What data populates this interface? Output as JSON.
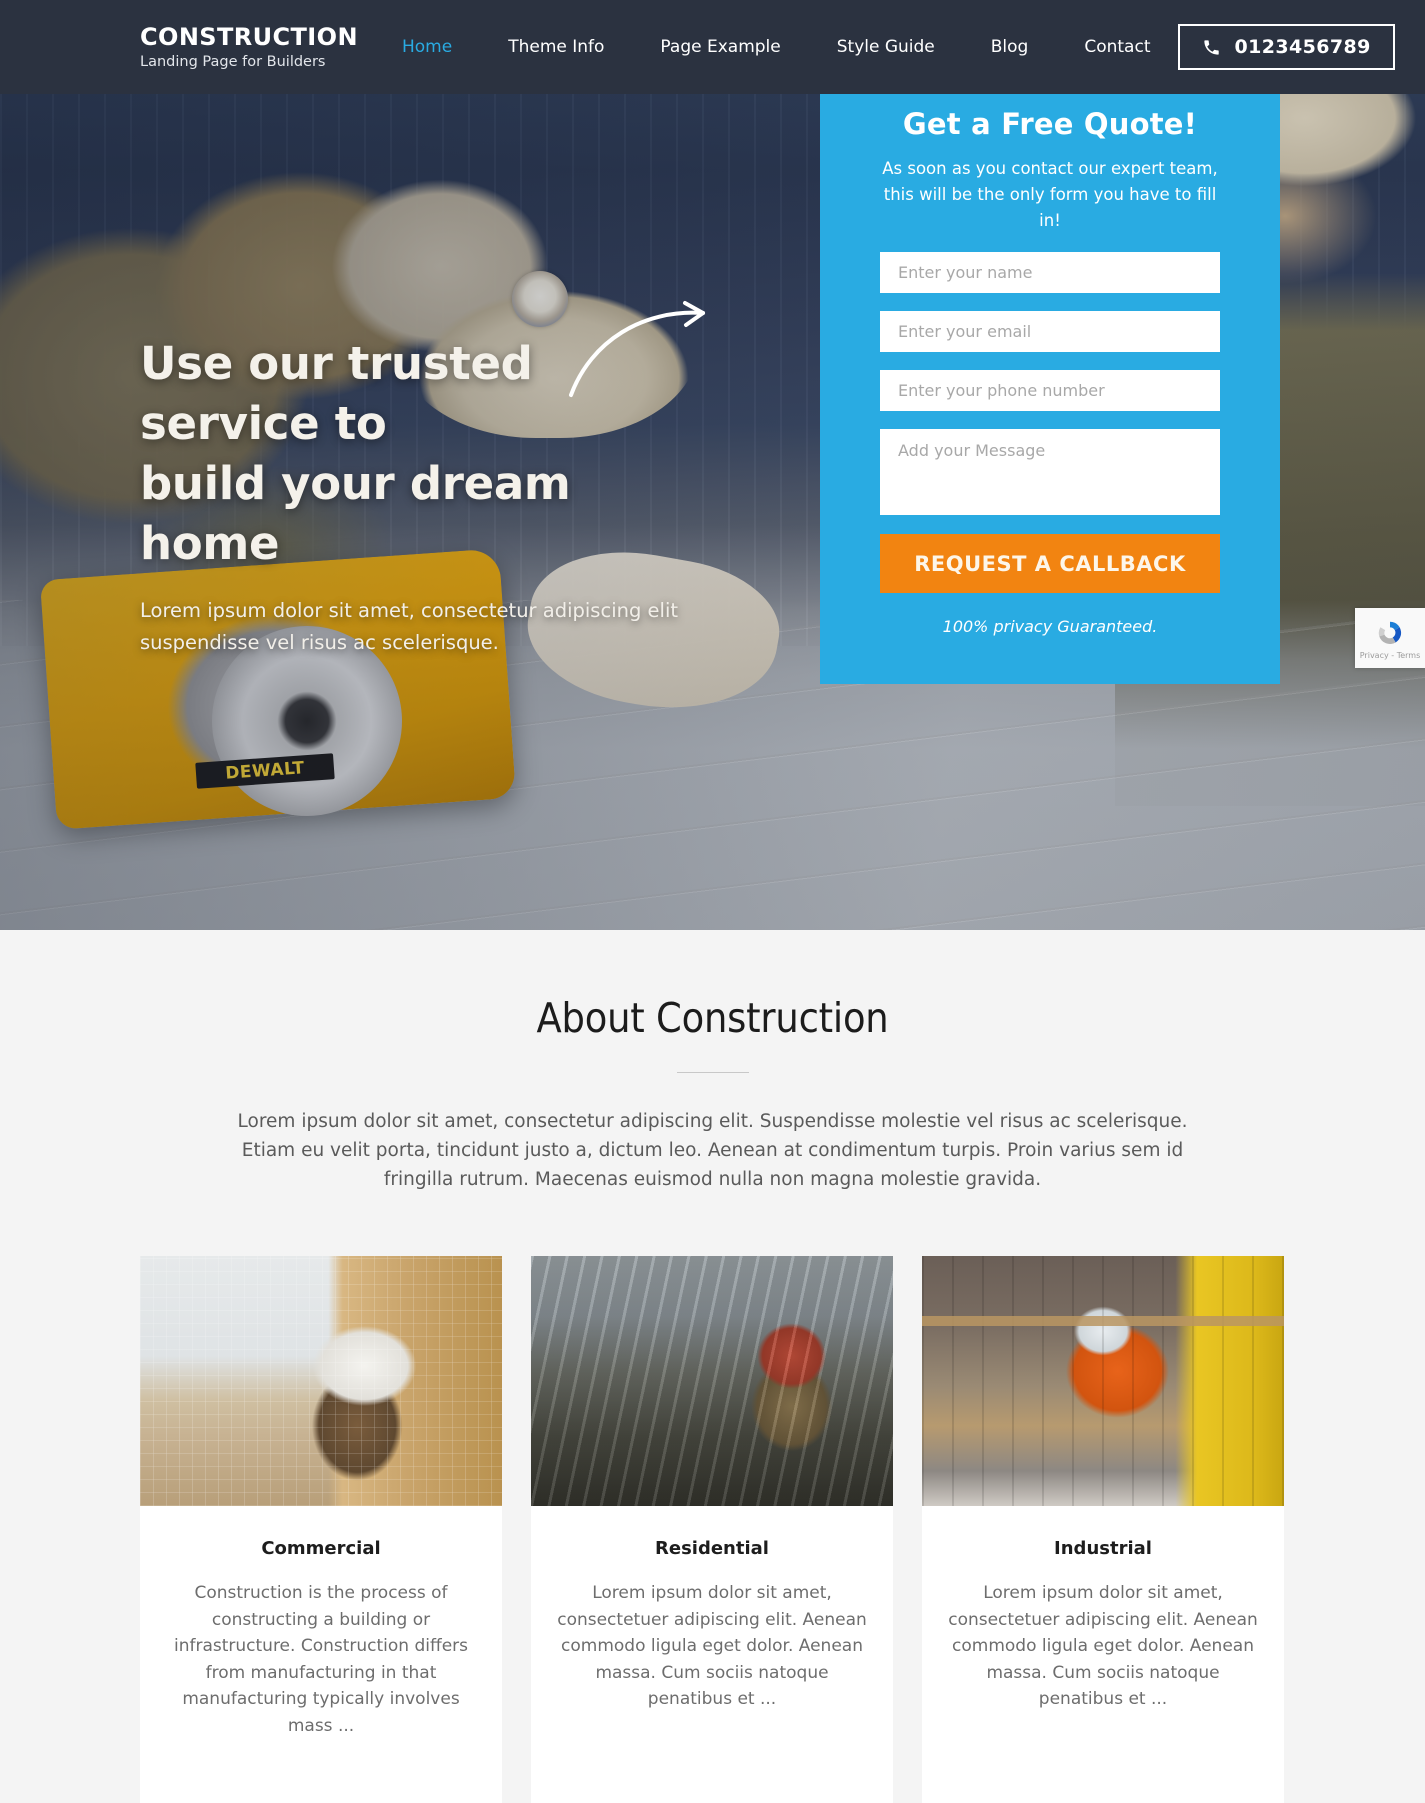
{
  "colors": {
    "header_bg": "#2b3240",
    "accent_blue": "#29abe2",
    "accent_orange": "#f28411",
    "nav_active": "#29abe2",
    "page_bg": "#f4f4f4",
    "card_bg": "#ffffff"
  },
  "header": {
    "brand_title": "CONSTRUCTION",
    "brand_subtitle": "Landing Page for Builders",
    "nav": [
      {
        "label": "Home",
        "active": true
      },
      {
        "label": "Theme Info",
        "active": false
      },
      {
        "label": "Page Example",
        "active": false
      },
      {
        "label": "Style Guide",
        "active": false
      },
      {
        "label": "Blog",
        "active": false
      },
      {
        "label": "Contact",
        "active": false
      }
    ],
    "phone": {
      "icon": "phone-icon",
      "number": "0123456789"
    }
  },
  "hero": {
    "title_line1": "Use our trusted service to",
    "title_line2": "build your dream home",
    "subtitle": "Lorem ipsum dolor sit amet, consectetur adipiscing elit suspendisse vel risus ac scelerisque.",
    "saw_brand": "DEWALT",
    "arrow_icon": "curved-arrow-icon"
  },
  "quote_form": {
    "title": "Get a Free Quote!",
    "description": "As soon as you contact our expert team, this will be the only form you have to fill in!",
    "fields": [
      {
        "name": "name",
        "placeholder": "Enter your name",
        "value": ""
      },
      {
        "name": "email",
        "placeholder": "Enter your email",
        "value": ""
      },
      {
        "name": "phone",
        "placeholder": "Enter your phone number",
        "value": ""
      }
    ],
    "message": {
      "placeholder": "Add your Message",
      "value": ""
    },
    "submit_label": "REQUEST A CALLBACK",
    "privacy_note": "100% privacy Guaranteed."
  },
  "recaptcha": {
    "icon": "recaptcha-icon",
    "links": "Privacy - Terms"
  },
  "about": {
    "title": "About Construction",
    "paragraph": "Lorem ipsum dolor sit amet, consectetur adipiscing elit. Suspendisse molestie vel risus ac scelerisque. Etiam eu velit porta, tincidunt justo a, dictum leo. Aenean at condimentum turpis. Proin varius sem id fringilla rutrum. Maecenas euismod nulla non magna molestie gravida.",
    "cards": [
      {
        "title": "Commercial",
        "text": "Construction is the process of constructing a building or infrastructure. Construction differs from manufacturing in that manufacturing typically involves mass ...",
        "photo": "construction-worker-plywood-photo"
      },
      {
        "title": "Residential",
        "text": "Lorem ipsum dolor sit amet, consectetuer adipiscing elit. Aenean commodo ligula eget dolor. Aenean massa. Cum sociis natoque penatibus et ...",
        "photo": "worker-rebar-ceiling-photo"
      },
      {
        "title": "Industrial",
        "text": "Lorem ipsum dolor sit amet, consectetuer adipiscing elit. Aenean commodo ligula eget dolor. Aenean massa. Cum sociis natoque penatibus et ...",
        "photo": "warehouse-pallet-worker-photo"
      }
    ]
  }
}
